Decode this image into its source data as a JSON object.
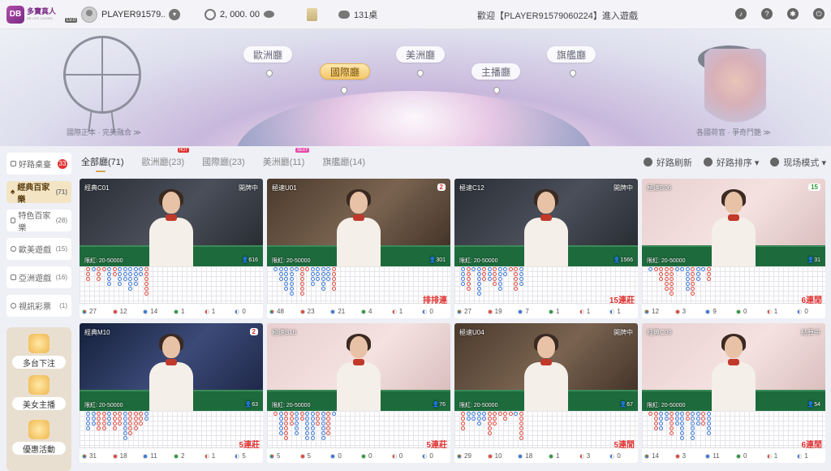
{
  "topbar": {
    "logo_cn": "多寶真人",
    "logo_en": "DB LIVE CASINO",
    "logo_badge": "DB",
    "username": "PLAYER91579...",
    "level": "LV.0",
    "balance": "2, 000. 00",
    "table_count": "131桌",
    "welcome": "歡迎【PLAYER91579060224】進入遊戲",
    "icons": [
      "speaker-icon",
      "help-icon",
      "settings-icon",
      "logout-icon"
    ]
  },
  "banner": {
    "halls": [
      {
        "label": "歐洲廳",
        "active": false
      },
      {
        "label": "美洲廳",
        "active": false
      },
      {
        "label": "國際廳",
        "active": true
      },
      {
        "label": "主播廳",
        "active": false
      },
      {
        "label": "旗艦廳",
        "active": false
      }
    ],
    "left_caption": "國際正本 · 完美融合 ≫",
    "right_caption": "各國荷官 · 爭奇鬥艷 ≫"
  },
  "sidebar": {
    "items": [
      {
        "label": "好路桌臺",
        "count": "33",
        "icon": "road-icon",
        "active": false,
        "red": true
      },
      {
        "label": "經典百家樂",
        "count": "(71)",
        "icon": "spade-icon",
        "active": true,
        "red": false
      },
      {
        "label": "特色百家樂",
        "count": "(28)",
        "icon": "card-icon",
        "active": false,
        "red": false
      },
      {
        "label": "歐美遊戲",
        "count": "(15)",
        "icon": "chip-icon",
        "active": false,
        "red": false
      },
      {
        "label": "亞洲遊戲",
        "count": "(16)",
        "icon": "dice-icon",
        "active": false,
        "red": false
      },
      {
        "label": "視訊彩票",
        "count": "(1)",
        "icon": "lottery-icon",
        "active": false,
        "red": false
      }
    ],
    "promos": [
      {
        "label": "多台下注",
        "icon": "multi-table-icon"
      },
      {
        "label": "美女主播",
        "icon": "microphone-icon"
      },
      {
        "label": "優惠活動",
        "icon": "gift-icon"
      }
    ]
  },
  "tabs": [
    {
      "label": "全部廳",
      "count": "(71)",
      "active": true,
      "badge": ""
    },
    {
      "label": "歐洲廳",
      "count": "(23)",
      "active": false,
      "badge": "HOT"
    },
    {
      "label": "國際廳",
      "count": "(23)",
      "active": false,
      "badge": ""
    },
    {
      "label": "美洲廳",
      "count": "(11)",
      "active": false,
      "badge": "SEXY"
    },
    {
      "label": "旗艦廳",
      "count": "(14)",
      "active": false,
      "badge": ""
    }
  ],
  "tools": {
    "refresh": "好路刷新",
    "sort": "好路排序",
    "mode": "现场模式"
  },
  "colors": {
    "banker": "#e0493c",
    "player": "#3a78d8",
    "tie": "#2a9a3a",
    "accent": "#d7a24a",
    "streak": "#e03333"
  },
  "cards": [
    {
      "name": "經典C01",
      "status": "開牌中",
      "timer": "",
      "limit": "限紅: 20-50000",
      "viewers": "616",
      "streak": "",
      "stats": [
        "27",
        "12",
        "14",
        "1",
        "1",
        "0"
      ],
      "scene": "dark"
    },
    {
      "name": "極速U01",
      "status": "",
      "timer": "2",
      "limit": "限紅: 20-50000",
      "viewers": "301",
      "streak": "排排連",
      "stats": [
        "48",
        "23",
        "21",
        "4",
        "1",
        "0"
      ],
      "scene": "warm"
    },
    {
      "name": "極速C12",
      "status": "開牌中",
      "timer": "",
      "limit": "限紅: 20-50000",
      "viewers": "1566",
      "streak": "15連莊",
      "stats": [
        "27",
        "19",
        "7",
        "1",
        "1",
        "1"
      ],
      "scene": "dark"
    },
    {
      "name": "極速B06",
      "status": "",
      "timer": "15",
      "limit": "限紅: 20-50000",
      "viewers": "31",
      "streak": "6連閒",
      "stats": [
        "12",
        "3",
        "9",
        "0",
        "1",
        "0"
      ],
      "scene": "pink",
      "timer_green": true
    },
    {
      "name": "經典M10",
      "status": "",
      "timer": "2",
      "limit": "限紅: 20-50000",
      "viewers": "63",
      "streak": "5連莊",
      "stats": [
        "31",
        "18",
        "11",
        "2",
        "1",
        "5"
      ],
      "scene": "night"
    },
    {
      "name": "極速B16",
      "status": "",
      "timer": "",
      "limit": "限紅: 20-50000",
      "viewers": "76",
      "streak": "5連莊",
      "stats": [
        "5",
        "5",
        "0",
        "0",
        "0",
        "0"
      ],
      "scene": "pink"
    },
    {
      "name": "極速U04",
      "status": "開牌中",
      "timer": "",
      "limit": "限紅: 20-50000",
      "viewers": "67",
      "streak": "5連閒",
      "stats": [
        "29",
        "10",
        "18",
        "1",
        "3",
        "0"
      ],
      "scene": "warm"
    },
    {
      "name": "經典C09",
      "status": "結算中",
      "timer": "",
      "limit": "限紅: 20-50000",
      "viewers": "54",
      "streak": "6連閒",
      "stats": [
        "14",
        "3",
        "11",
        "0",
        "1",
        "1"
      ],
      "scene": "pink"
    }
  ]
}
